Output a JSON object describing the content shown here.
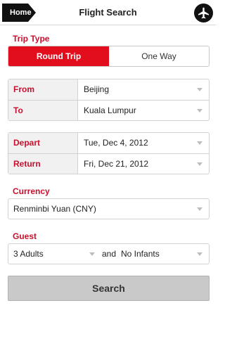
{
  "header": {
    "home_label": "Home",
    "title": "Flight Search"
  },
  "trip_type": {
    "label": "Trip Type",
    "options": [
      "Round Trip",
      "One Way"
    ],
    "selected": "Round Trip"
  },
  "route": {
    "from_label": "From",
    "from_value": "Beijing",
    "to_label": "To",
    "to_value": "Kuala Lumpur"
  },
  "dates": {
    "depart_label": "Depart",
    "depart_value": "Tue, Dec 4, 2012",
    "return_label": "Return",
    "return_value": "Fri, Dec 21, 2012"
  },
  "currency": {
    "label": "Currency",
    "value": "Renminbi Yuan (CNY)"
  },
  "guest": {
    "label": "Guest",
    "adults_value": "3 Adults",
    "connector": "and",
    "infants_value": "No Infants"
  },
  "search_button_label": "Search",
  "colors": {
    "accent": "#c8102e",
    "active_segment": "#e20e1e",
    "button_bg": "#c9c9c9"
  },
  "icons": {
    "home": "back-arrow-icon",
    "plane": "airplane-icon",
    "dropdown": "chevron-down-icon"
  }
}
